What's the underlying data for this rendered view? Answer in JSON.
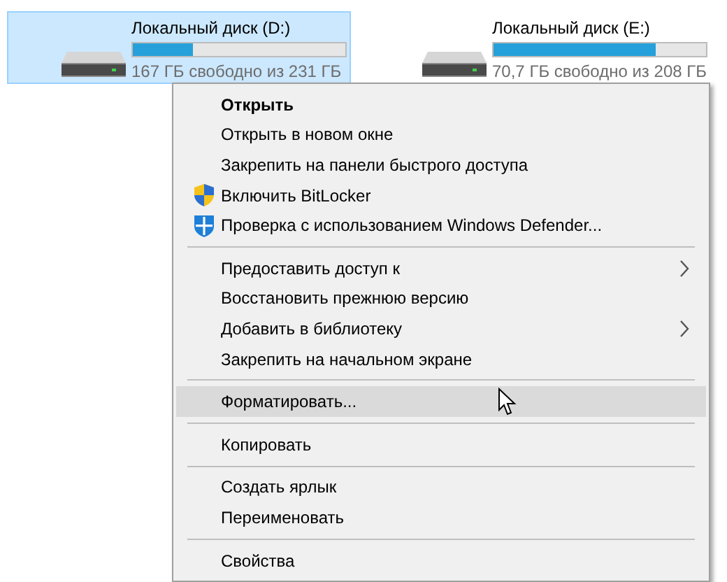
{
  "drives": [
    {
      "name": "Локальный диск (D:)",
      "level": 0.28,
      "free": "167 ГБ свободно из 231 ГБ",
      "selected": true
    },
    {
      "name": "Локальный диск (E:)",
      "level": 0.76,
      "free": "70,7 ГБ свободно из 208 ГБ",
      "selected": false
    }
  ],
  "context_menu": {
    "items": [
      {
        "kind": "command",
        "label": "Открыть",
        "default": true,
        "selected": false
      },
      {
        "kind": "command",
        "label": "Открыть в новом окне",
        "selected": false
      },
      {
        "kind": "command",
        "label": "Закрепить на панели быстрого доступа",
        "selected": false
      },
      {
        "kind": "uac",
        "label": "Включить BitLocker",
        "selected": false
      },
      {
        "kind": "defender",
        "label": "Проверка с использованием Windows Defender...",
        "selected": false
      },
      {
        "kind": "separator"
      },
      {
        "kind": "command",
        "label": "Предоставить доступ к",
        "submenu": true,
        "selected": false
      },
      {
        "kind": "command",
        "label": "Восстановить прежнюю версию",
        "selected": false
      },
      {
        "kind": "command",
        "label": "Добавить в библиотеку",
        "submenu": true,
        "selected": false
      },
      {
        "kind": "command",
        "label": "Закрепить на начальном экране",
        "selected": false
      },
      {
        "kind": "separator"
      },
      {
        "kind": "command",
        "label": "Форматировать...",
        "selected": true
      },
      {
        "kind": "separator"
      },
      {
        "kind": "command",
        "label": "Копировать",
        "selected": false
      },
      {
        "kind": "separator"
      },
      {
        "kind": "command",
        "label": "Создать ярлык",
        "selected": false
      },
      {
        "kind": "command",
        "label": "Переименовать",
        "selected": false
      },
      {
        "kind": "separator"
      },
      {
        "kind": "command",
        "label": "Свойства",
        "selected": false
      }
    ]
  }
}
